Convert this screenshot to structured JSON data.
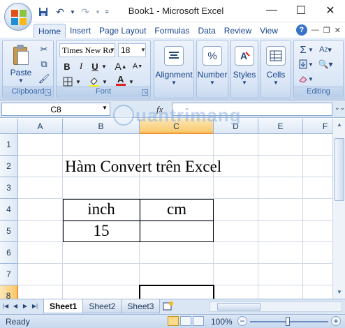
{
  "window": {
    "title": "Book1 - Microsoft Excel"
  },
  "qat": {
    "save": "save-icon",
    "undo": "undo-icon",
    "redo": "redo-icon"
  },
  "ribbon": {
    "tabs": [
      "Home",
      "Insert",
      "Page Layout",
      "Formulas",
      "Data",
      "Review",
      "View"
    ],
    "active_tab": "Home",
    "clipboard": {
      "paste_label": "Paste",
      "group_label": "Clipboard"
    },
    "font": {
      "name": "Times New Ro",
      "size": "18",
      "group_label": "Font"
    },
    "alignment_label": "Alignment",
    "number_label": "Number",
    "styles_label": "Styles",
    "cells_label": "Cells",
    "editing_label": "Editing"
  },
  "formula_bar": {
    "name_box": "C8",
    "fx": "fx",
    "formula": ""
  },
  "grid": {
    "columns": [
      "A",
      "B",
      "C",
      "D",
      "E",
      "F"
    ],
    "selected_column": "C",
    "rows": [
      "1",
      "2",
      "3",
      "4",
      "5",
      "6",
      "7",
      "8"
    ],
    "selected_row": "8",
    "cells": {
      "B2": "Hàm Convert trên Excel",
      "B4": "inch",
      "C4": "cm",
      "B5": "15",
      "C5": ""
    }
  },
  "sheets": {
    "tabs": [
      "Sheet1",
      "Sheet2",
      "Sheet3"
    ],
    "active": "Sheet1"
  },
  "status": {
    "text": "Ready",
    "zoom": "100%"
  },
  "watermark": {
    "text": "uantrimang"
  }
}
